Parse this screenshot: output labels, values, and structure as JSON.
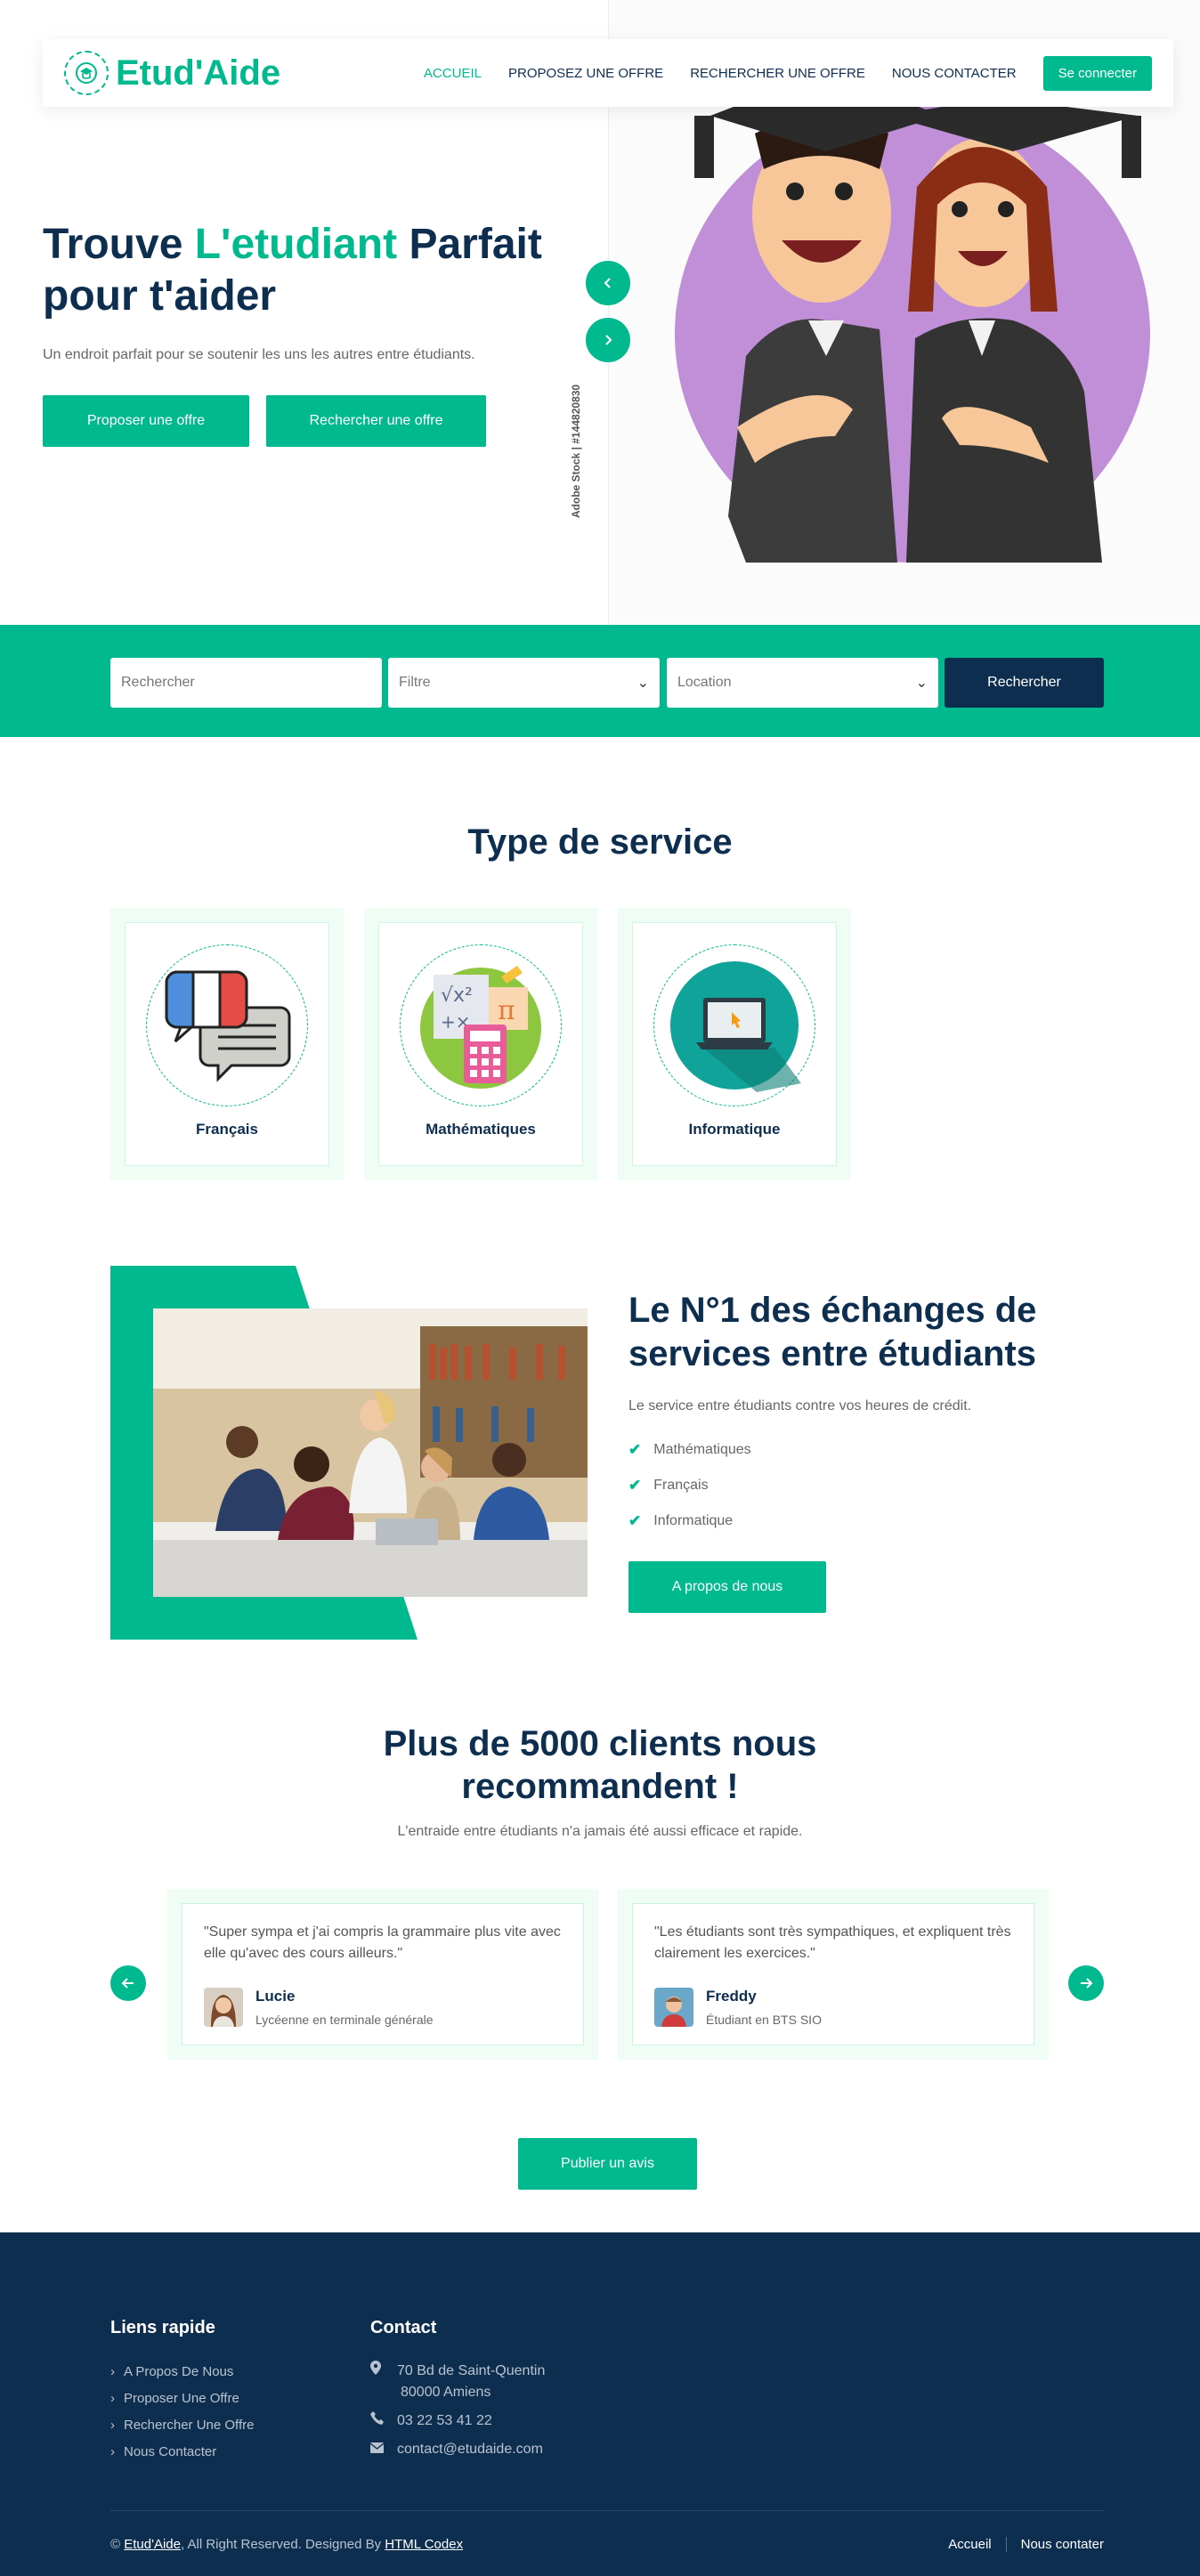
{
  "brand": {
    "name": "Etud'Aide",
    "accent": "#00b98e",
    "dark": "#0e2e50"
  },
  "nav": {
    "links": [
      "ACCUEIL",
      "PROPOSEZ UNE OFFRE",
      "RECHERCHER UNE OFFRE",
      "NOUS CONTACTER"
    ],
    "active": "ACCUEIL",
    "login": "Se connecter"
  },
  "hero": {
    "title_part1": "Trouve ",
    "title_highlight": "L'etudiant",
    "title_part2": " Parfait pour t'aider",
    "subtitle": "Un endroit parfait pour se soutenir les uns les autres entre étudiants.",
    "btn_offer": "Proposer une offre",
    "btn_search": "Rechercher une offre",
    "image_credit": "Adobe Stock | #144820830"
  },
  "search": {
    "query_placeholder": "Rechercher",
    "filter_value": "Filtre",
    "location_value": "Location",
    "button": "Rechercher"
  },
  "services": {
    "title": "Type de service",
    "items": [
      {
        "label": "Français",
        "icon": "speech-bubbles-french-flag-icon"
      },
      {
        "label": "Mathématiques",
        "icon": "math-calculator-icon"
      },
      {
        "label": "Informatique",
        "icon": "laptop-icon"
      }
    ]
  },
  "about": {
    "title": "Le N°1 des échanges de services entre étudiants",
    "subtitle": "Le service entre étudiants contre vos heures de crédit.",
    "checklist": [
      "Mathématiques",
      "Français",
      "Informatique"
    ],
    "button": "A propos de nous"
  },
  "testimonials": {
    "title": "Plus de 5000 clients nous recommandent !",
    "subtitle": "L'entraide entre étudiants n'a jamais été aussi efficace et rapide.",
    "items": [
      {
        "quote": "\"Super sympa et j'ai compris la grammaire plus vite avec elle qu'avec des cours ailleurs.\"",
        "name": "Lucie",
        "role": "Lycéenne en terminale générale"
      },
      {
        "quote": "\"Les étudiants sont très sympathiques, et expliquent très clairement les exercices.\"",
        "name": "Freddy",
        "role": "Étudiant en BTS SIO"
      }
    ],
    "publish": "Publier un avis"
  },
  "footer": {
    "links_title": "Liens rapide",
    "links": [
      "A Propos De Nous",
      "Proposer Une Offre",
      "Rechercher Une Offre",
      "Nous Contacter"
    ],
    "contact_title": "Contact",
    "address_line1": "70 Bd de Saint-Quentin",
    "address_line2": "80000 Amiens",
    "phone": "03 22 53 41 22",
    "email": "contact@etudaide.com",
    "copy_prefix": "© ",
    "copy_brand": "Etud'Aide",
    "copy_mid": ", All Right Reserved. Designed By ",
    "copy_designer": "HTML Codex",
    "bottom_links": [
      "Accueil",
      "Nous contater"
    ]
  }
}
